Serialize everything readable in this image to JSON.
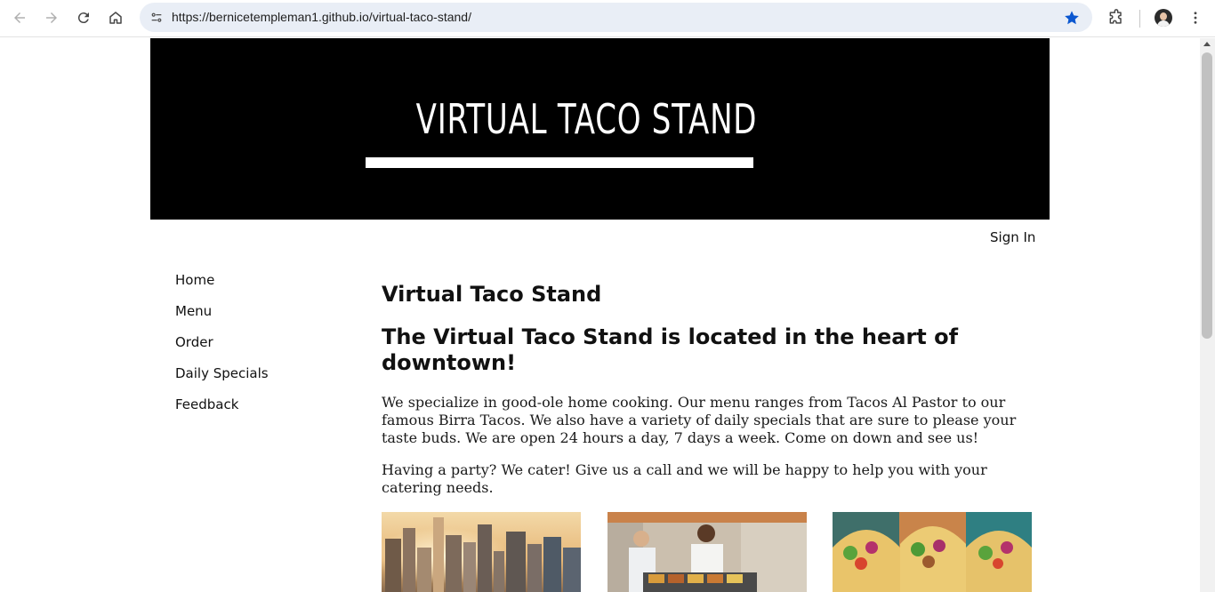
{
  "browser": {
    "url": "https://bernicetempleman1.github.io/virtual-taco-stand/",
    "icons": [
      "back-icon",
      "forward-icon",
      "reload-icon",
      "home-icon",
      "site-info-icon",
      "bookmark-star-icon",
      "extensions-icon",
      "profile-avatar",
      "more-menu-icon"
    ],
    "accent": "#0b57d0"
  },
  "banner": {
    "title": "VIRTUAL TACO STAND",
    "background": "#000000"
  },
  "header": {
    "sign_in": "Sign In"
  },
  "sidebar": {
    "items": [
      {
        "label": "Home"
      },
      {
        "label": "Menu"
      },
      {
        "label": "Order"
      },
      {
        "label": "Daily Specials"
      },
      {
        "label": "Feedback"
      }
    ]
  },
  "main": {
    "title": "Virtual Taco Stand",
    "subtitle": "The Virtual Taco Stand is located in the heart of downtown!",
    "paragraph1": "We specialize in good-ole home cooking. Our menu ranges from Tacos Al Pastor to our famous Birra Tacos. We also have a variety of daily specials that are sure to please your taste buds. We are open 24 hours a day, 7 days a week. Come on down and see us!",
    "paragraph2": "Having a party? We cater! Give us a call and we will be happy to help you with your catering needs."
  },
  "photos": [
    {
      "subject": "city-skyline-photo"
    },
    {
      "subject": "taco-stand-vendors-photo"
    },
    {
      "subject": "tacos-photo"
    }
  ]
}
